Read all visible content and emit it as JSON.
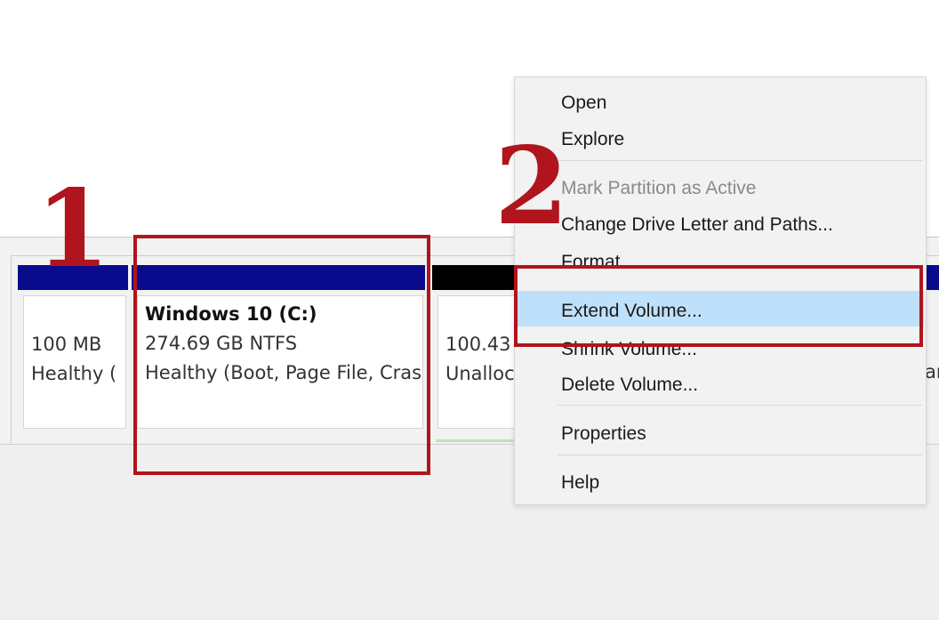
{
  "annotations": {
    "step1": "1",
    "step2": "2"
  },
  "partitions": [
    {
      "id": "system-reserved",
      "line1": "100 MB",
      "line2": "Healthy (",
      "bar_color": "#0a0a8c"
    },
    {
      "id": "windows-c",
      "title": "Windows 10  (C:)",
      "line1": "274.69 GB NTFS",
      "line2": "Healthy (Boot, Page File, Cras",
      "bar_color": "#0a0a8c"
    },
    {
      "id": "unallocated",
      "line1": "100.43",
      "line2": "Unalloc",
      "bar_color": "#000000"
    }
  ],
  "edge_text": "ar",
  "context_menu": {
    "items": [
      {
        "label": "Open",
        "enabled": true
      },
      {
        "label": "Explore",
        "enabled": true
      },
      {
        "label": "Mark Partition as Active",
        "enabled": false
      },
      {
        "label": "Change Drive Letter and Paths...",
        "enabled": true
      },
      {
        "label": "Format...",
        "enabled": true
      },
      {
        "label": "Extend Volume...",
        "enabled": true,
        "highlighted": true
      },
      {
        "label": "Shrink Volume...",
        "enabled": true
      },
      {
        "label": "Delete Volume...",
        "enabled": true
      },
      {
        "label": "Properties",
        "enabled": true
      },
      {
        "label": "Help",
        "enabled": true
      }
    ]
  },
  "colors": {
    "annotation_red": "#b0141c",
    "primary_partition_blue": "#0a0a8c",
    "menu_highlight": "#bfe0fa"
  }
}
